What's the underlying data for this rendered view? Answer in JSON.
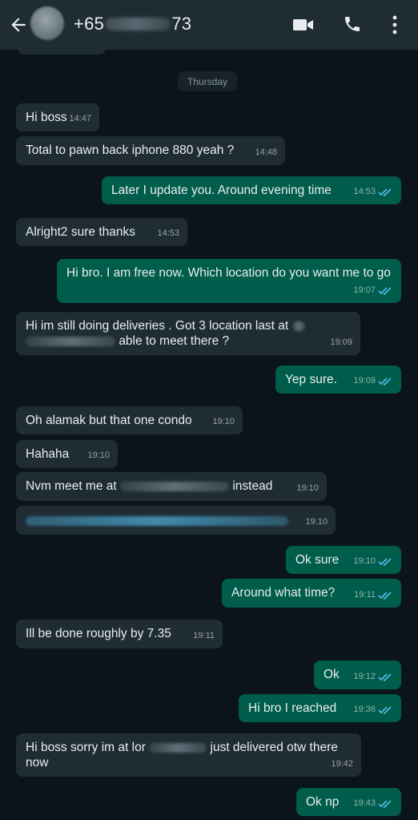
{
  "header": {
    "contact_prefix": "+65",
    "contact_suffix": "73",
    "back_icon": "arrow-left-icon",
    "video_icon": "video-camera-icon",
    "call_icon": "phone-icon",
    "menu_icon": "more-vertical-icon"
  },
  "chat": {
    "date_chip": "Thursday",
    "messages": [
      {
        "dir": "in",
        "text": "Hi boss",
        "time": "14:47"
      },
      {
        "dir": "in",
        "text": "Total to pawn back iphone 880 yeah ?",
        "time": "14:48"
      },
      {
        "dir": "out",
        "text": "Later I update you. Around evening time",
        "time": "14:53",
        "status": "read"
      },
      {
        "dir": "in",
        "text": "Alright2 sure thanks",
        "time": "14:53"
      },
      {
        "dir": "out",
        "text": "Hi bro. I am free now. Which location do you want me to go",
        "time": "19:07",
        "status": "read"
      },
      {
        "dir": "in",
        "text_a": "Hi im still doing deliveries . Got 3 location last at",
        "text_b": "able to meet there ?",
        "time": "19:09"
      },
      {
        "dir": "out",
        "text": "Yep sure.",
        "time": "19:09",
        "status": "read"
      },
      {
        "dir": "in",
        "text": "Oh alamak but that one condo",
        "time": "19:10"
      },
      {
        "dir": "in",
        "text": "Hahaha",
        "time": "19:10"
      },
      {
        "dir": "in",
        "text_a": "Nvm meet me at",
        "text_b": "instead",
        "time": "19:10"
      },
      {
        "dir": "in",
        "text": "",
        "time": "19:10",
        "link": true
      },
      {
        "dir": "out",
        "text": "Ok sure",
        "time": "19:10",
        "status": "read"
      },
      {
        "dir": "out",
        "text": "Around what time?",
        "time": "19:11",
        "status": "read"
      },
      {
        "dir": "in",
        "text": "Ill be done roughly by 7.35",
        "time": "19:11"
      },
      {
        "dir": "out",
        "text": "Ok",
        "time": "19:12",
        "status": "read"
      },
      {
        "dir": "out",
        "text": "Hi bro I reached",
        "time": "19:36",
        "status": "read"
      },
      {
        "dir": "in",
        "text_a": "Hi boss sorry im at lor",
        "text_b": "just delivered otw there now",
        "time": "19:42"
      },
      {
        "dir": "out",
        "text": "Ok np",
        "time": "19:43",
        "status": "read"
      }
    ]
  },
  "colors": {
    "header_bg": "#1f2c34",
    "chat_bg": "#0b141a",
    "incoming_bubble": "#1f2c34",
    "outgoing_bubble": "#005c4b",
    "read_tick": "#53bdeb"
  }
}
